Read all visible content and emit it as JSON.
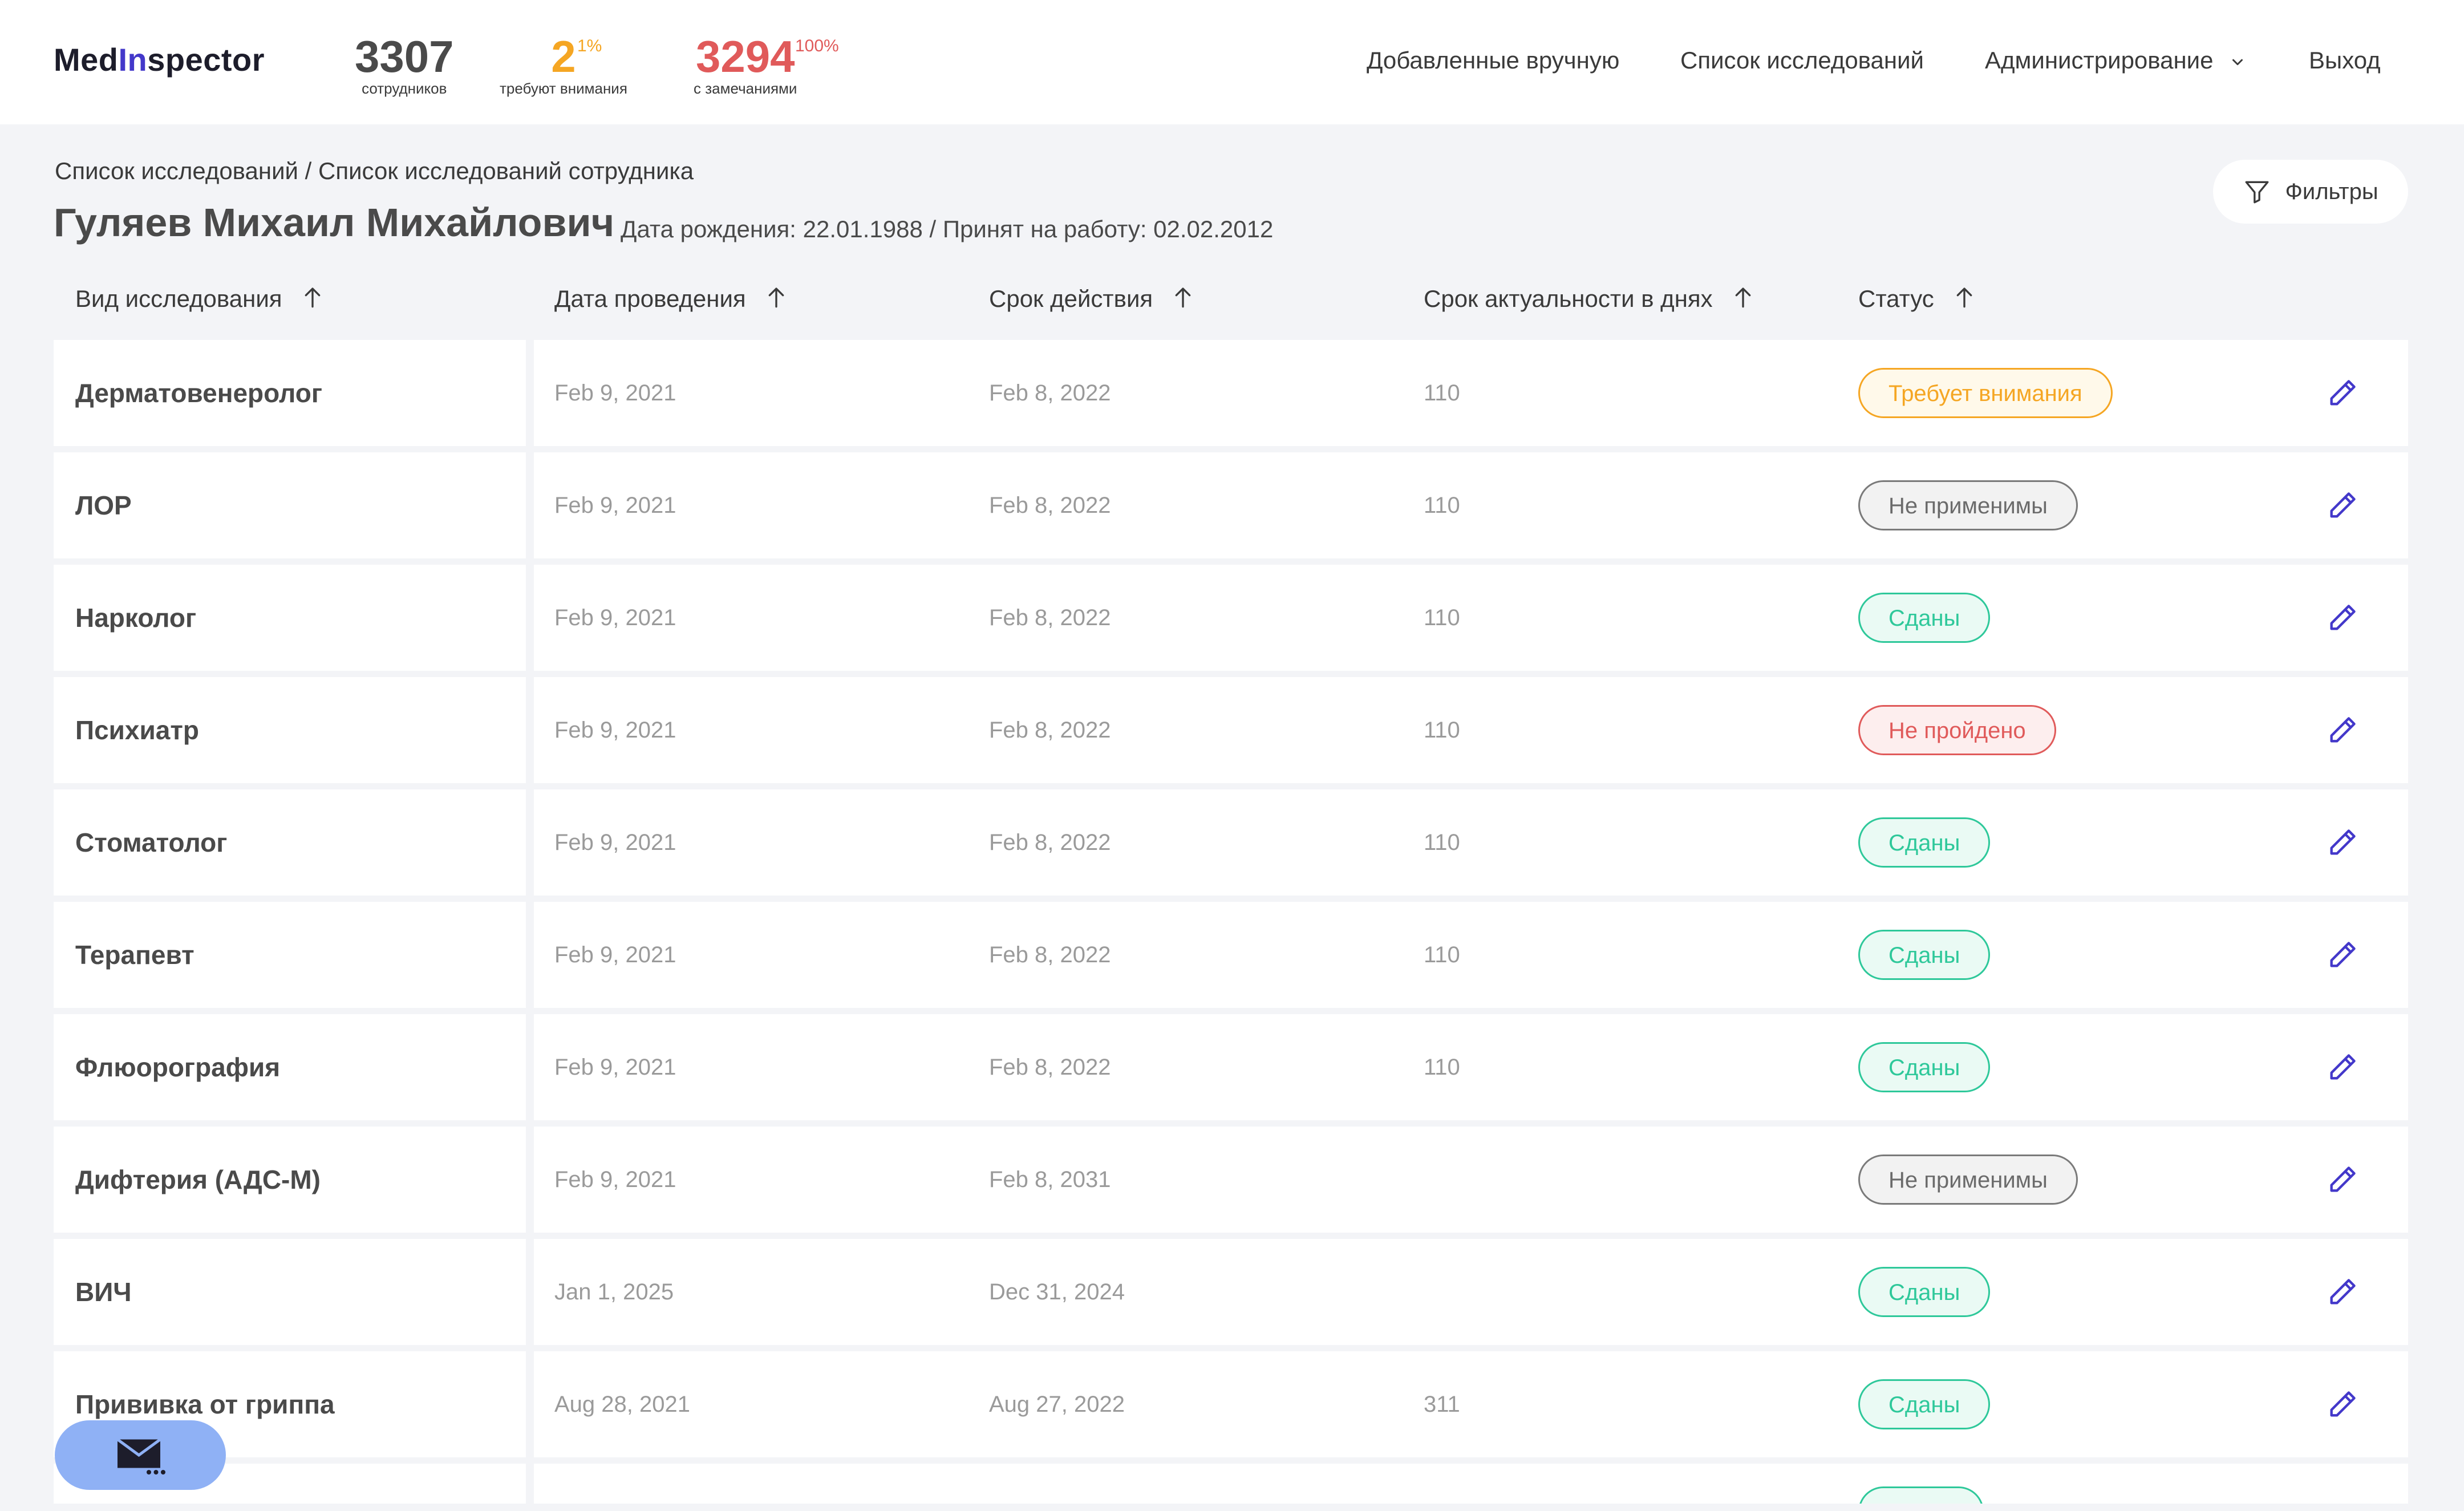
{
  "app": {
    "logo_prefix": "Med",
    "logo_accent": "In",
    "logo_suffix": "spector"
  },
  "stats": [
    {
      "value": "3307",
      "percent": "",
      "label": "сотрудников"
    },
    {
      "value": "2",
      "percent": "1%",
      "label": "требуют внимания"
    },
    {
      "value": "3294",
      "percent": "100%",
      "label": "с замечаниями"
    }
  ],
  "nav": {
    "manual": "Добавленные вручную",
    "studies": "Список исследований",
    "admin": "Администрирование",
    "logout": "Выход"
  },
  "breadcrumb": "Список исследований / Список исследований сотрудника",
  "employee": {
    "name": "Гуляев Михаил Михайлович",
    "info": "Дата рождения: 22.01.1988 / Принят на работу: 02.02.2012"
  },
  "filter_label": "Фильтры",
  "columns": {
    "type": "Вид исследования",
    "date": "Дата проведения",
    "expiry": "Срок действия",
    "days": "Срок актуальности в днях",
    "status": "Статус"
  },
  "rows": [
    {
      "name": "Дерматовенеролог",
      "date": "Feb 9, 2021",
      "expiry": "Feb 8, 2022",
      "days": "110",
      "status": "Требует внимания",
      "status_kind": "warn"
    },
    {
      "name": "ЛОР",
      "date": "Feb 9, 2021",
      "expiry": "Feb 8, 2022",
      "days": "110",
      "status": "Не применимы",
      "status_kind": "na"
    },
    {
      "name": "Нарколог",
      "date": "Feb 9, 2021",
      "expiry": "Feb 8, 2022",
      "days": "110",
      "status": "Сданы",
      "status_kind": "ok"
    },
    {
      "name": "Психиатр",
      "date": "Feb 9, 2021",
      "expiry": "Feb 8, 2022",
      "days": "110",
      "status": "Не пройдено",
      "status_kind": "fail"
    },
    {
      "name": "Стоматолог",
      "date": "Feb 9, 2021",
      "expiry": "Feb 8, 2022",
      "days": "110",
      "status": "Сданы",
      "status_kind": "ok"
    },
    {
      "name": "Терапевт",
      "date": "Feb 9, 2021",
      "expiry": "Feb 8, 2022",
      "days": "110",
      "status": "Сданы",
      "status_kind": "ok"
    },
    {
      "name": "Флюорография",
      "date": "Feb 9, 2021",
      "expiry": "Feb 8, 2022",
      "days": "110",
      "status": "Сданы",
      "status_kind": "ok"
    },
    {
      "name": "Дифтерия (АДС-М)",
      "date": "Feb 9, 2021",
      "expiry": "Feb 8, 2031",
      "days": "",
      "status": "Не применимы",
      "status_kind": "na"
    },
    {
      "name": "ВИЧ",
      "date": "Jan 1, 2025",
      "expiry": "Dec 31, 2024",
      "days": "",
      "status": "Сданы",
      "status_kind": "ok"
    },
    {
      "name": "Прививка от гриппа",
      "date": "Aug 28, 2021",
      "expiry": "Aug 27, 2022",
      "days": "311",
      "status": "Сданы",
      "status_kind": "ok"
    },
    {
      "name": "",
      "date": "",
      "expiry": "",
      "days": "",
      "status": "",
      "status_kind": "ok"
    }
  ],
  "icons": {
    "filter": "filter-icon",
    "sort": "arrow-up-icon",
    "edit": "pencil-icon",
    "mail": "mail-icon",
    "chevron": "chevron-down-icon"
  },
  "colors": {
    "accent": "#4338ca",
    "warning": "#f5a623",
    "danger": "#e05a5a",
    "success": "#2ec89a",
    "neutral": "#7a7a7a",
    "fab": "#8fb1f5"
  }
}
